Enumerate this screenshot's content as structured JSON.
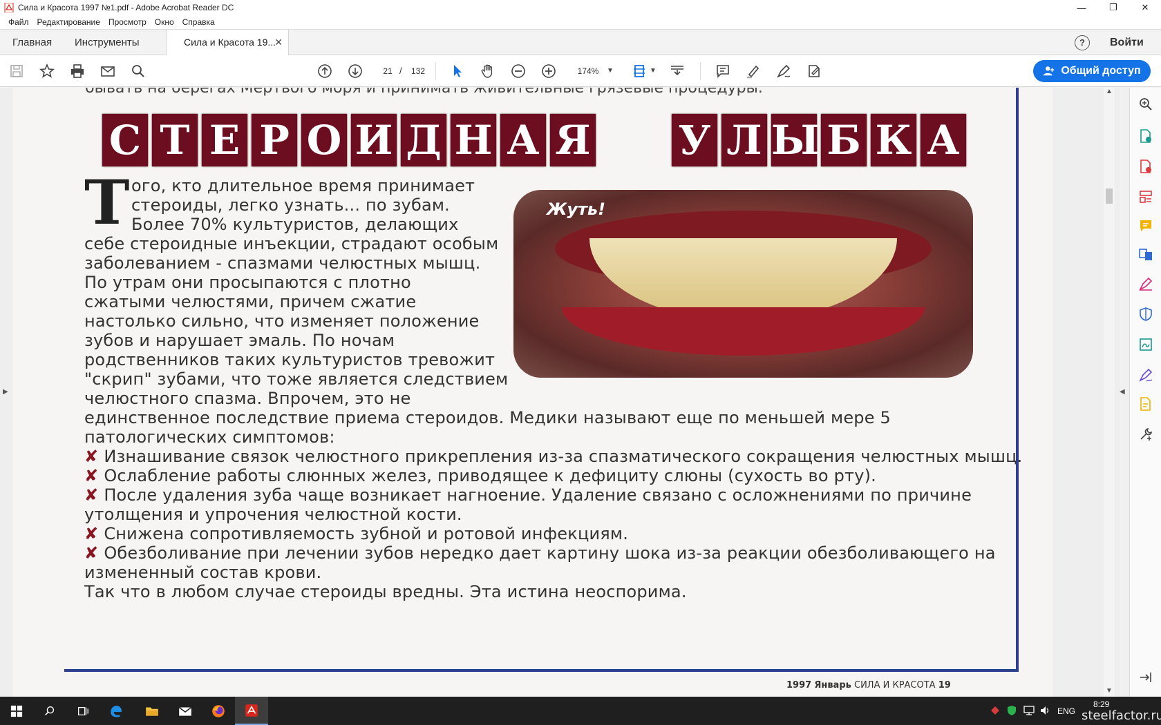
{
  "window": {
    "title": "Сила и Красота 1997 №1.pdf - Adobe Acrobat Reader DC",
    "minimize": "—",
    "maximize": "❐",
    "close": "✕"
  },
  "menu": [
    "Файл",
    "Редактирование",
    "Просмотр",
    "Окно",
    "Справка"
  ],
  "tabs": {
    "home": "Главная",
    "tools": "Инструменты",
    "document": "Сила и Красота 19...",
    "close": "✕",
    "help": "?",
    "sign_in": "Войти"
  },
  "toolbar": {
    "current_page": "21",
    "page_separator": "/",
    "total_pages": "132",
    "zoom": "174%",
    "share_label": "Общий доступ",
    "accent_color": "#1473e6"
  },
  "document": {
    "cut_line": "бывать на берегах Мертвого моря и принимать живительные грязевые процедуры.",
    "title_letters": [
      "С",
      "Т",
      "Е",
      "Р",
      "О",
      "И",
      "Д",
      "Н",
      "А",
      "Я",
      "У",
      "Л",
      "Ы",
      "Б",
      "К",
      "А"
    ],
    "drop_cap": "Т",
    "photo_caption": "Жуть!",
    "paragraph_lines": [
      "ого, кто длительное время принимает",
      "стероиды, легко узнать... по зубам.",
      "Более 70% культуристов, делающих",
      "себе стероидные инъекции, страдают особым",
      "заболеванием - спазмами челюстных мышц.",
      "По утрам они просыпаются с плотно",
      "сжатыми челюстями, причем сжатие",
      "настолько сильно, что изменяет положение",
      "зубов и нарушает эмаль. По ночам",
      "родственников таких культуристов тревожит",
      "\"скрип\" зубами, что тоже является следствием",
      "челюстного спазма. Впрочем, это не",
      "единственное последствие приема стероидов. Медики называют еще по меньшей мере 5",
      "патологических симптомов:"
    ],
    "bullet_mark": "✘",
    "bullets": [
      "Изнашивание связок челюстного прикрепления из-за спазматического сокращения челюстных мышц.",
      "Ослабление работы слюнных желез, приводящее к дефициту слюны (сухость во рту).",
      "После удаления зуба чаще возникает нагноение. Удаление связано с осложнениями по причине",
      "утолщения и упрочения челюстной кости.",
      "Снижена сопротивляемость зубной и ротовой инфекциям.",
      "Обезболивание при лечении зубов нередко дает картину шока из-за реакции обезболивающего на",
      "измененный состав крови."
    ],
    "conclusion": "Так что в любом случае стероиды вредны. Эта истина неоспорима.",
    "footer_year": "1997",
    "footer_month": "Январь",
    "footer_magazine": "СИЛА И КРАСОТА",
    "footer_page": "19",
    "title_tile_color": "#6d0e20",
    "border_color": "#2c3e8c"
  },
  "taskbar": {
    "lang": "ENG",
    "time": "8:29",
    "watermark": "steelfactor.ru"
  }
}
